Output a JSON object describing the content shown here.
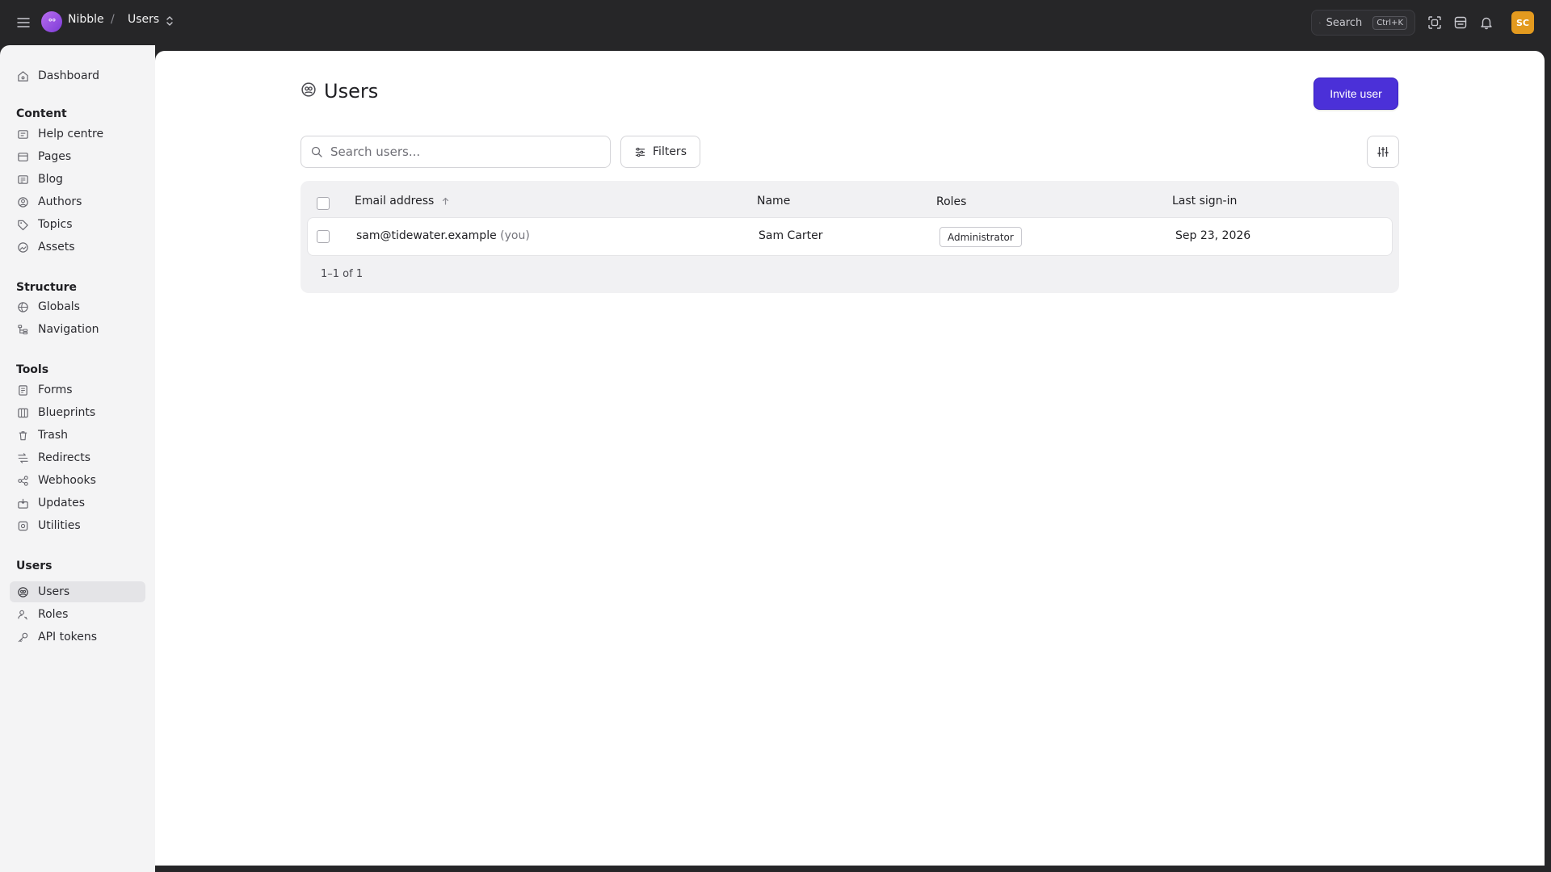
{
  "topbar": {
    "site_name": "Nibble",
    "separator": "/",
    "breadcrumb_current": "Users",
    "search_label": "Search",
    "search_shortcut": "Ctrl+K",
    "avatar_initials": "SC"
  },
  "sidebar": {
    "dashboard": "Dashboard",
    "groups": [
      {
        "heading": "Content",
        "items": [
          "Help centre",
          "Pages",
          "Blog",
          "Authors",
          "Topics",
          "Assets"
        ]
      },
      {
        "heading": "Structure",
        "items": [
          "Globals",
          "Navigation"
        ]
      },
      {
        "heading": "Tools",
        "items": [
          "Forms",
          "Blueprints",
          "Trash",
          "Redirects",
          "Webhooks",
          "Updates",
          "Utilities"
        ]
      },
      {
        "heading": "Users",
        "items": [
          "Users",
          "Roles",
          "API tokens"
        ]
      }
    ],
    "active_item": "Users"
  },
  "main": {
    "title": "Users",
    "invite_button": "Invite user",
    "search_placeholder": "Search users...",
    "filters_button": "Filters",
    "table": {
      "columns": [
        "Email address",
        "Name",
        "Roles",
        "Last sign-in"
      ],
      "sort_column": "Email address",
      "sort_direction": "ascending",
      "rows": [
        {
          "email": "sam@tidewater.example",
          "you_tag": "(you)",
          "name": "Sam Carter",
          "role": "Administrator",
          "last_sign_in": "Sep 23, 2026"
        }
      ],
      "pagination": "1–1 of 1"
    }
  },
  "colors": {
    "accent": "#4b30d8",
    "topbar_bg": "#262628",
    "avatar_bg": "#e39a1f",
    "sidebar_bg": "#f4f4f5"
  }
}
